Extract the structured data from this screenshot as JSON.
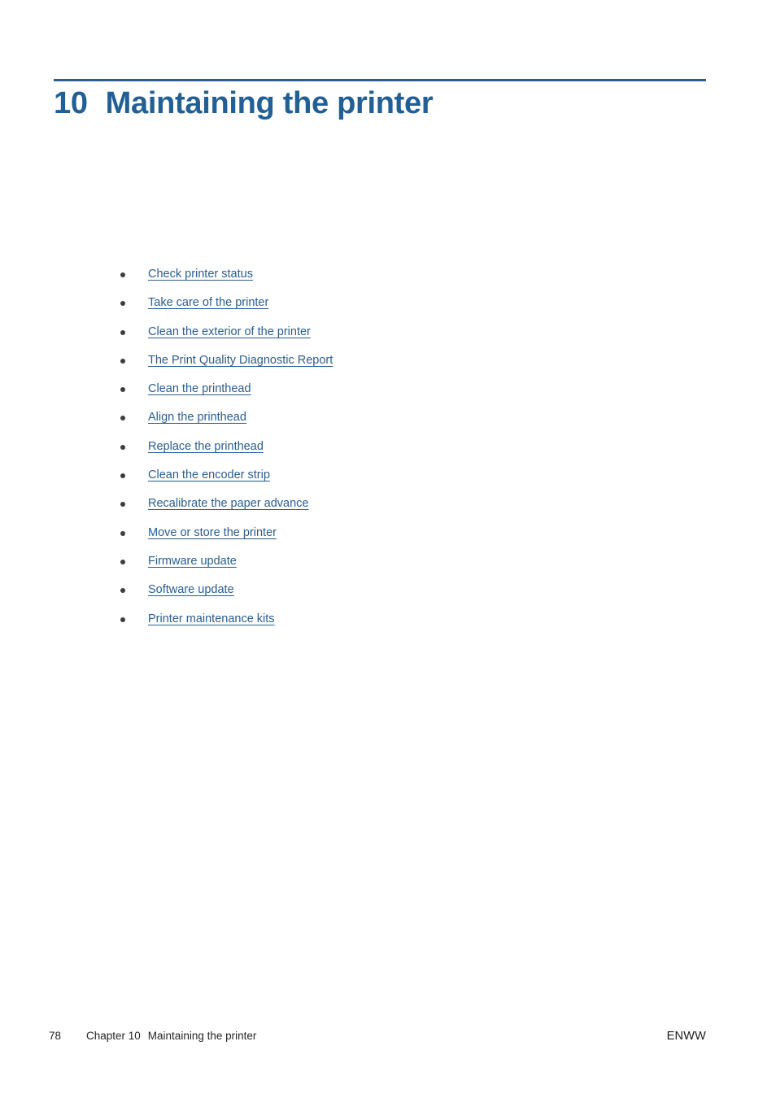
{
  "document": {
    "chapter_number": "10",
    "chapter_title": "Maintaining the printer",
    "rule_color": "#2a5d8f",
    "heading_color": "#215f94",
    "link_color": "#2a5d8f"
  },
  "toc": {
    "items": [
      {
        "label": "Check printer status"
      },
      {
        "label": "Take care of the printer"
      },
      {
        "label": "Clean the exterior of the printer"
      },
      {
        "label": "The Print Quality Diagnostic Report"
      },
      {
        "label": "Clean the printhead"
      },
      {
        "label": "Align the printhead"
      },
      {
        "label": "Replace the printhead"
      },
      {
        "label": "Clean the encoder strip"
      },
      {
        "label": "Recalibrate the paper advance"
      },
      {
        "label": "Move or store the printer"
      },
      {
        "label": "Firmware update"
      },
      {
        "label": "Software update"
      },
      {
        "label": "Printer maintenance kits"
      }
    ]
  },
  "footer": {
    "page_number": "78",
    "chapter_label": "Chapter 10",
    "chapter_title": "Maintaining the printer",
    "right_label": "ENWW"
  }
}
